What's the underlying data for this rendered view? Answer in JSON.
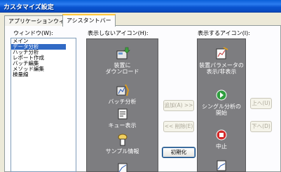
{
  "window": {
    "title": "カスタマイズ設定"
  },
  "tabs": [
    {
      "label": "アプリケーションウィンドウ"
    },
    {
      "label": "アシスタントバー"
    }
  ],
  "window_list": {
    "label": "ウィンドウ(W):",
    "items": [
      "メイン",
      "データ分析",
      "ハッチ分析",
      "レポート作成",
      "バッチ編集",
      "メソッド編集",
      "検量線"
    ],
    "selected_index": 1
  },
  "hidden_icons": {
    "label": "表示しないアイコン(H):",
    "items": [
      {
        "label": "装置に\nダウンロード",
        "icon": "download-icon"
      },
      {
        "label": "バッチ分析",
        "icon": "batch-analysis-icon"
      },
      {
        "label": "キュー表示",
        "icon": "queue-icon"
      },
      {
        "label": "サンプル情報",
        "icon": "sample-info-icon"
      }
    ]
  },
  "shown_icons": {
    "label": "表示するアイコン(I):",
    "items": [
      {
        "label": "装置パラメータの\n表示/非表示",
        "icon": "instrument-params-icon"
      },
      {
        "label": "シングル分析の\n開始",
        "icon": "start-single-icon"
      },
      {
        "label": "中止",
        "icon": "stop-icon"
      }
    ]
  },
  "buttons": {
    "add": "追加(A) >>",
    "remove": "<< 削除(E)",
    "reset": "初期化",
    "up": "上へ(U)",
    "down": "下へ(D)"
  },
  "colors": {
    "selection": "#316ac5",
    "panel": "#7d7d80",
    "title_bar": "#0a5fd8"
  }
}
